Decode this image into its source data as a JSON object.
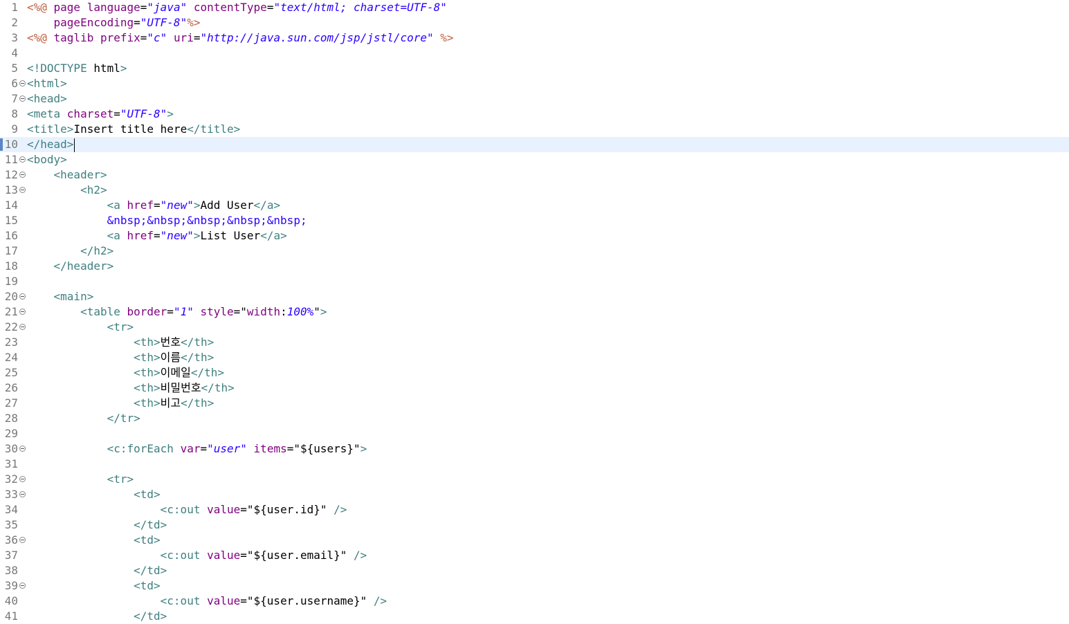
{
  "colors": {
    "jsp_delimiter": "#bf5f3f",
    "tag": "#3f7f7f",
    "attribute": "#7f007f",
    "attribute_value": "#2a00ff",
    "text": "#000000",
    "current_line": "#e8f2fe",
    "line_number": "#787878"
  },
  "editor": {
    "current_line": 10,
    "lines": [
      {
        "n": "1",
        "fold": false,
        "tokens": [
          [
            "jsp",
            "<%@ "
          ],
          [
            "attr",
            "page "
          ],
          [
            "attr",
            "language"
          ],
          [
            "text",
            "="
          ],
          [
            "val",
            "\"java\""
          ],
          [
            "text",
            " "
          ],
          [
            "attr",
            "contentType"
          ],
          [
            "text",
            "="
          ],
          [
            "val",
            "\"text/html; charset=UTF-8\""
          ]
        ]
      },
      {
        "n": "2",
        "fold": false,
        "tokens": [
          [
            "text",
            "    "
          ],
          [
            "attr",
            "pageEncoding"
          ],
          [
            "text",
            "="
          ],
          [
            "val",
            "\"UTF-8\""
          ],
          [
            "jsp",
            "%>"
          ]
        ]
      },
      {
        "n": "3",
        "fold": false,
        "tokens": [
          [
            "jsp",
            "<%@ "
          ],
          [
            "attr",
            "taglib "
          ],
          [
            "attr",
            "prefix"
          ],
          [
            "text",
            "="
          ],
          [
            "val",
            "\"c\""
          ],
          [
            "text",
            " "
          ],
          [
            "attr",
            "uri"
          ],
          [
            "text",
            "="
          ],
          [
            "val",
            "\"http://java.sun.com/jsp/jstl/core\""
          ],
          [
            "text",
            " "
          ],
          [
            "jsp",
            "%>"
          ]
        ]
      },
      {
        "n": "4",
        "fold": false,
        "tokens": []
      },
      {
        "n": "5",
        "fold": false,
        "tokens": [
          [
            "tag",
            "<!DOCTYPE "
          ],
          [
            "el",
            "html"
          ],
          [
            "tag",
            ">"
          ]
        ]
      },
      {
        "n": "6",
        "fold": true,
        "tokens": [
          [
            "tag",
            "<html>"
          ]
        ]
      },
      {
        "n": "7",
        "fold": true,
        "tokens": [
          [
            "tag",
            "<head>"
          ]
        ]
      },
      {
        "n": "8",
        "fold": false,
        "tokens": [
          [
            "tag",
            "<meta "
          ],
          [
            "attr",
            "charset"
          ],
          [
            "text",
            "="
          ],
          [
            "val",
            "\"UTF-8\""
          ],
          [
            "tag",
            ">"
          ]
        ]
      },
      {
        "n": "9",
        "fold": false,
        "tokens": [
          [
            "tag",
            "<title>"
          ],
          [
            "text",
            "Insert title here"
          ],
          [
            "tag",
            "</title>"
          ]
        ]
      },
      {
        "n": "10",
        "fold": false,
        "tokens": [
          [
            "tag",
            "</head>"
          ]
        ]
      },
      {
        "n": "11",
        "fold": true,
        "tokens": [
          [
            "tag",
            "<body>"
          ]
        ]
      },
      {
        "n": "12",
        "fold": true,
        "tokens": [
          [
            "text",
            "    "
          ],
          [
            "tag",
            "<header>"
          ]
        ]
      },
      {
        "n": "13",
        "fold": true,
        "tokens": [
          [
            "text",
            "        "
          ],
          [
            "tag",
            "<h2>"
          ]
        ]
      },
      {
        "n": "14",
        "fold": false,
        "tokens": [
          [
            "text",
            "            "
          ],
          [
            "tag",
            "<a "
          ],
          [
            "attr",
            "href"
          ],
          [
            "text",
            "="
          ],
          [
            "val",
            "\"new\""
          ],
          [
            "tag",
            ">"
          ],
          [
            "text",
            "Add User"
          ],
          [
            "tag",
            "</a>"
          ]
        ]
      },
      {
        "n": "15",
        "fold": false,
        "tokens": [
          [
            "text",
            "            "
          ],
          [
            "ent",
            "&nbsp;&nbsp;&nbsp;&nbsp;&nbsp;"
          ]
        ]
      },
      {
        "n": "16",
        "fold": false,
        "tokens": [
          [
            "text",
            "            "
          ],
          [
            "tag",
            "<a "
          ],
          [
            "attr",
            "href"
          ],
          [
            "text",
            "="
          ],
          [
            "val",
            "\"new\""
          ],
          [
            "tag",
            ">"
          ],
          [
            "text",
            "List User"
          ],
          [
            "tag",
            "</a>"
          ]
        ]
      },
      {
        "n": "17",
        "fold": false,
        "tokens": [
          [
            "text",
            "        "
          ],
          [
            "tag",
            "</h2>"
          ]
        ]
      },
      {
        "n": "18",
        "fold": false,
        "tokens": [
          [
            "text",
            "    "
          ],
          [
            "tag",
            "</header>"
          ]
        ]
      },
      {
        "n": "19",
        "fold": false,
        "tokens": []
      },
      {
        "n": "20",
        "fold": true,
        "tokens": [
          [
            "text",
            "    "
          ],
          [
            "tag",
            "<main>"
          ]
        ]
      },
      {
        "n": "21",
        "fold": true,
        "tokens": [
          [
            "text",
            "        "
          ],
          [
            "tag",
            "<table "
          ],
          [
            "attr",
            "border"
          ],
          [
            "text",
            "="
          ],
          [
            "val",
            "\"1\""
          ],
          [
            "text",
            " "
          ],
          [
            "attr",
            "style"
          ],
          [
            "text",
            "=\""
          ],
          [
            "attr",
            "width"
          ],
          [
            "text",
            ":"
          ],
          [
            "val",
            "100%"
          ],
          [
            "text",
            "\""
          ],
          [
            "tag",
            ">"
          ]
        ]
      },
      {
        "n": "22",
        "fold": true,
        "tokens": [
          [
            "text",
            "            "
          ],
          [
            "tag",
            "<tr>"
          ]
        ]
      },
      {
        "n": "23",
        "fold": false,
        "tokens": [
          [
            "text",
            "                "
          ],
          [
            "tag",
            "<th>"
          ],
          [
            "text",
            "번호"
          ],
          [
            "tag",
            "</th>"
          ]
        ]
      },
      {
        "n": "24",
        "fold": false,
        "tokens": [
          [
            "text",
            "                "
          ],
          [
            "tag",
            "<th>"
          ],
          [
            "text",
            "이름"
          ],
          [
            "tag",
            "</th>"
          ]
        ]
      },
      {
        "n": "25",
        "fold": false,
        "tokens": [
          [
            "text",
            "                "
          ],
          [
            "tag",
            "<th>"
          ],
          [
            "text",
            "이메일"
          ],
          [
            "tag",
            "</th>"
          ]
        ]
      },
      {
        "n": "26",
        "fold": false,
        "tokens": [
          [
            "text",
            "                "
          ],
          [
            "tag",
            "<th>"
          ],
          [
            "text",
            "비밀번호"
          ],
          [
            "tag",
            "</th>"
          ]
        ]
      },
      {
        "n": "27",
        "fold": false,
        "tokens": [
          [
            "text",
            "                "
          ],
          [
            "tag",
            "<th>"
          ],
          [
            "text",
            "비고"
          ],
          [
            "tag",
            "</th>"
          ]
        ]
      },
      {
        "n": "28",
        "fold": false,
        "tokens": [
          [
            "text",
            "            "
          ],
          [
            "tag",
            "</tr>"
          ]
        ]
      },
      {
        "n": "29",
        "fold": false,
        "tokens": []
      },
      {
        "n": "30",
        "fold": true,
        "tokens": [
          [
            "text",
            "            "
          ],
          [
            "tag",
            "<c:forEach "
          ],
          [
            "attr",
            "var"
          ],
          [
            "text",
            "="
          ],
          [
            "val",
            "\"user\""
          ],
          [
            "text",
            " "
          ],
          [
            "attr",
            "items"
          ],
          [
            "text",
            "=\""
          ],
          [
            "el",
            "${users}"
          ],
          [
            "text",
            "\""
          ],
          [
            "tag",
            ">"
          ]
        ]
      },
      {
        "n": "31",
        "fold": false,
        "tokens": []
      },
      {
        "n": "32",
        "fold": true,
        "tokens": [
          [
            "text",
            "            "
          ],
          [
            "tag",
            "<tr>"
          ]
        ]
      },
      {
        "n": "33",
        "fold": true,
        "tokens": [
          [
            "text",
            "                "
          ],
          [
            "tag",
            "<td>"
          ]
        ]
      },
      {
        "n": "34",
        "fold": false,
        "tokens": [
          [
            "text",
            "                    "
          ],
          [
            "tag",
            "<c:out "
          ],
          [
            "attr",
            "value"
          ],
          [
            "text",
            "=\""
          ],
          [
            "el",
            "${user.id}"
          ],
          [
            "text",
            "\" "
          ],
          [
            "tag",
            "/>"
          ]
        ]
      },
      {
        "n": "35",
        "fold": false,
        "tokens": [
          [
            "text",
            "                "
          ],
          [
            "tag",
            "</td>"
          ]
        ]
      },
      {
        "n": "36",
        "fold": true,
        "tokens": [
          [
            "text",
            "                "
          ],
          [
            "tag",
            "<td>"
          ]
        ]
      },
      {
        "n": "37",
        "fold": false,
        "tokens": [
          [
            "text",
            "                    "
          ],
          [
            "tag",
            "<c:out "
          ],
          [
            "attr",
            "value"
          ],
          [
            "text",
            "=\""
          ],
          [
            "el",
            "${user.email}"
          ],
          [
            "text",
            "\" "
          ],
          [
            "tag",
            "/>"
          ]
        ]
      },
      {
        "n": "38",
        "fold": false,
        "tokens": [
          [
            "text",
            "                "
          ],
          [
            "tag",
            "</td>"
          ]
        ]
      },
      {
        "n": "39",
        "fold": true,
        "tokens": [
          [
            "text",
            "                "
          ],
          [
            "tag",
            "<td>"
          ]
        ]
      },
      {
        "n": "40",
        "fold": false,
        "tokens": [
          [
            "text",
            "                    "
          ],
          [
            "tag",
            "<c:out "
          ],
          [
            "attr",
            "value"
          ],
          [
            "text",
            "=\""
          ],
          [
            "el",
            "${user.username}"
          ],
          [
            "text",
            "\" "
          ],
          [
            "tag",
            "/>"
          ]
        ]
      },
      {
        "n": "41",
        "fold": false,
        "tokens": [
          [
            "text",
            "                "
          ],
          [
            "tag",
            "</td>"
          ]
        ]
      }
    ]
  }
}
